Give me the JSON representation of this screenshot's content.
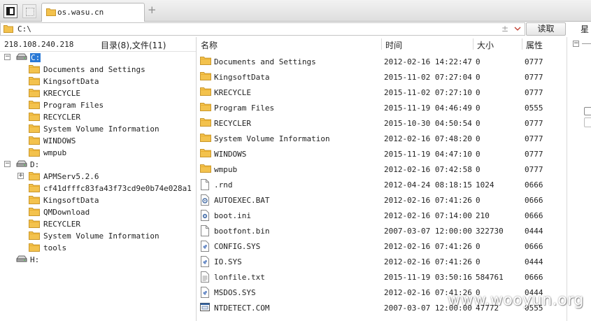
{
  "tab": {
    "title": "os.wasu.cn",
    "add_label": "+"
  },
  "address": {
    "path": "C:\\",
    "read_button": "读取",
    "right_label": "星"
  },
  "left": {
    "ip": "218.108.240.218",
    "count": "目录(8),文件(11)",
    "tree": [
      {
        "label": "C:",
        "type": "drive",
        "depth": 0,
        "expander": "−",
        "selected": true
      },
      {
        "label": "Documents and Settings",
        "type": "folder",
        "depth": 1
      },
      {
        "label": "KingsoftData",
        "type": "folder",
        "depth": 1
      },
      {
        "label": "KRECYCLE",
        "type": "folder",
        "depth": 1
      },
      {
        "label": "Program Files",
        "type": "folder",
        "depth": 1
      },
      {
        "label": "RECYCLER",
        "type": "folder",
        "depth": 1
      },
      {
        "label": "System Volume Information",
        "type": "folder",
        "depth": 1
      },
      {
        "label": "WINDOWS",
        "type": "folder",
        "depth": 1
      },
      {
        "label": "wmpub",
        "type": "folder",
        "depth": 1
      },
      {
        "label": "D:",
        "type": "drive",
        "depth": 0,
        "expander": "−"
      },
      {
        "label": "APMServ5.2.6",
        "type": "folder",
        "depth": 1,
        "expander": "+"
      },
      {
        "label": "cf41dfffc83fa43f73cd9e0b74e028a1",
        "type": "folder",
        "depth": 1
      },
      {
        "label": "KingsoftData",
        "type": "folder",
        "depth": 1
      },
      {
        "label": "QMDownload",
        "type": "folder",
        "depth": 1
      },
      {
        "label": "RECYCLER",
        "type": "folder",
        "depth": 1
      },
      {
        "label": "System Volume Information",
        "type": "folder",
        "depth": 1
      },
      {
        "label": "tools",
        "type": "folder",
        "depth": 1
      },
      {
        "label": "H:",
        "type": "drive",
        "depth": 0
      }
    ]
  },
  "columns": {
    "name": "名称",
    "time": "时间",
    "size": "大小",
    "attr": "属性"
  },
  "files": [
    {
      "name": "Documents and Settings",
      "time": "2012-02-16 14:22:47",
      "size": "0",
      "attr": "0777",
      "icon": "folder"
    },
    {
      "name": "KingsoftData",
      "time": "2015-11-02 07:27:04",
      "size": "0",
      "attr": "0777",
      "icon": "folder"
    },
    {
      "name": "KRECYCLE",
      "time": "2015-11-02 07:27:10",
      "size": "0",
      "attr": "0777",
      "icon": "folder"
    },
    {
      "name": "Program Files",
      "time": "2015-11-19 04:46:49",
      "size": "0",
      "attr": "0555",
      "icon": "folder"
    },
    {
      "name": "RECYCLER",
      "time": "2015-10-30 04:50:54",
      "size": "0",
      "attr": "0777",
      "icon": "folder"
    },
    {
      "name": "System Volume Information",
      "time": "2012-02-16 07:48:20",
      "size": "0",
      "attr": "0777",
      "icon": "folder"
    },
    {
      "name": "WINDOWS",
      "time": "2015-11-19 04:47:10",
      "size": "0",
      "attr": "0777",
      "icon": "folder"
    },
    {
      "name": "wmpub",
      "time": "2012-02-16 07:42:58",
      "size": "0",
      "attr": "0777",
      "icon": "folder"
    },
    {
      "name": ".rnd",
      "time": "2012-04-24 08:18:15",
      "size": "1024",
      "attr": "0666",
      "icon": "file"
    },
    {
      "name": "AUTOEXEC.BAT",
      "time": "2012-02-16 07:41:26",
      "size": "0",
      "attr": "0666",
      "icon": "bat"
    },
    {
      "name": "boot.ini",
      "time": "2012-02-16 07:14:00",
      "size": "210",
      "attr": "0666",
      "icon": "ini"
    },
    {
      "name": "bootfont.bin",
      "time": "2007-03-07 12:00:00",
      "size": "322730",
      "attr": "0444",
      "icon": "file"
    },
    {
      "name": "CONFIG.SYS",
      "time": "2012-02-16 07:41:26",
      "size": "0",
      "attr": "0666",
      "icon": "sys"
    },
    {
      "name": "IO.SYS",
      "time": "2012-02-16 07:41:26",
      "size": "0",
      "attr": "0444",
      "icon": "sys"
    },
    {
      "name": "lonfile.txt",
      "time": "2015-11-19 03:50:16",
      "size": "584761",
      "attr": "0666",
      "icon": "txt"
    },
    {
      "name": "MSDOS.SYS",
      "time": "2012-02-16 07:41:26",
      "size": "0",
      "attr": "0444",
      "icon": "sys"
    },
    {
      "name": "NTDETECT.COM",
      "time": "2007-03-07 12:00:00",
      "size": "47772",
      "attr": "0555",
      "icon": "com"
    }
  ],
  "watermark": "www.wooyun.org",
  "colors": {
    "selection": "#2a79d6",
    "folder": "#f3c24d",
    "folder_edge": "#c9962a"
  }
}
